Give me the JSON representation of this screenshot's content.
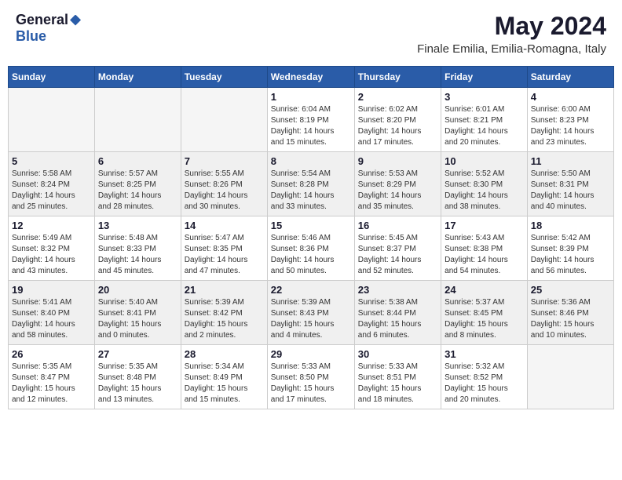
{
  "header": {
    "logo_general": "General",
    "logo_blue": "Blue",
    "month_year": "May 2024",
    "location": "Finale Emilia, Emilia-Romagna, Italy"
  },
  "days_of_week": [
    "Sunday",
    "Monday",
    "Tuesday",
    "Wednesday",
    "Thursday",
    "Friday",
    "Saturday"
  ],
  "weeks": [
    [
      {
        "day": "",
        "info": "",
        "empty": true
      },
      {
        "day": "",
        "info": "",
        "empty": true
      },
      {
        "day": "",
        "info": "",
        "empty": true
      },
      {
        "day": "1",
        "info": "Sunrise: 6:04 AM\nSunset: 8:19 PM\nDaylight: 14 hours\nand 15 minutes.",
        "empty": false
      },
      {
        "day": "2",
        "info": "Sunrise: 6:02 AM\nSunset: 8:20 PM\nDaylight: 14 hours\nand 17 minutes.",
        "empty": false
      },
      {
        "day": "3",
        "info": "Sunrise: 6:01 AM\nSunset: 8:21 PM\nDaylight: 14 hours\nand 20 minutes.",
        "empty": false
      },
      {
        "day": "4",
        "info": "Sunrise: 6:00 AM\nSunset: 8:23 PM\nDaylight: 14 hours\nand 23 minutes.",
        "empty": false
      }
    ],
    [
      {
        "day": "5",
        "info": "Sunrise: 5:58 AM\nSunset: 8:24 PM\nDaylight: 14 hours\nand 25 minutes.",
        "empty": false,
        "shaded": true
      },
      {
        "day": "6",
        "info": "Sunrise: 5:57 AM\nSunset: 8:25 PM\nDaylight: 14 hours\nand 28 minutes.",
        "empty": false,
        "shaded": true
      },
      {
        "day": "7",
        "info": "Sunrise: 5:55 AM\nSunset: 8:26 PM\nDaylight: 14 hours\nand 30 minutes.",
        "empty": false,
        "shaded": true
      },
      {
        "day": "8",
        "info": "Sunrise: 5:54 AM\nSunset: 8:28 PM\nDaylight: 14 hours\nand 33 minutes.",
        "empty": false,
        "shaded": true
      },
      {
        "day": "9",
        "info": "Sunrise: 5:53 AM\nSunset: 8:29 PM\nDaylight: 14 hours\nand 35 minutes.",
        "empty": false,
        "shaded": true
      },
      {
        "day": "10",
        "info": "Sunrise: 5:52 AM\nSunset: 8:30 PM\nDaylight: 14 hours\nand 38 minutes.",
        "empty": false,
        "shaded": true
      },
      {
        "day": "11",
        "info": "Sunrise: 5:50 AM\nSunset: 8:31 PM\nDaylight: 14 hours\nand 40 minutes.",
        "empty": false,
        "shaded": true
      }
    ],
    [
      {
        "day": "12",
        "info": "Sunrise: 5:49 AM\nSunset: 8:32 PM\nDaylight: 14 hours\nand 43 minutes.",
        "empty": false
      },
      {
        "day": "13",
        "info": "Sunrise: 5:48 AM\nSunset: 8:33 PM\nDaylight: 14 hours\nand 45 minutes.",
        "empty": false
      },
      {
        "day": "14",
        "info": "Sunrise: 5:47 AM\nSunset: 8:35 PM\nDaylight: 14 hours\nand 47 minutes.",
        "empty": false
      },
      {
        "day": "15",
        "info": "Sunrise: 5:46 AM\nSunset: 8:36 PM\nDaylight: 14 hours\nand 50 minutes.",
        "empty": false
      },
      {
        "day": "16",
        "info": "Sunrise: 5:45 AM\nSunset: 8:37 PM\nDaylight: 14 hours\nand 52 minutes.",
        "empty": false
      },
      {
        "day": "17",
        "info": "Sunrise: 5:43 AM\nSunset: 8:38 PM\nDaylight: 14 hours\nand 54 minutes.",
        "empty": false
      },
      {
        "day": "18",
        "info": "Sunrise: 5:42 AM\nSunset: 8:39 PM\nDaylight: 14 hours\nand 56 minutes.",
        "empty": false
      }
    ],
    [
      {
        "day": "19",
        "info": "Sunrise: 5:41 AM\nSunset: 8:40 PM\nDaylight: 14 hours\nand 58 minutes.",
        "empty": false,
        "shaded": true
      },
      {
        "day": "20",
        "info": "Sunrise: 5:40 AM\nSunset: 8:41 PM\nDaylight: 15 hours\nand 0 minutes.",
        "empty": false,
        "shaded": true
      },
      {
        "day": "21",
        "info": "Sunrise: 5:39 AM\nSunset: 8:42 PM\nDaylight: 15 hours\nand 2 minutes.",
        "empty": false,
        "shaded": true
      },
      {
        "day": "22",
        "info": "Sunrise: 5:39 AM\nSunset: 8:43 PM\nDaylight: 15 hours\nand 4 minutes.",
        "empty": false,
        "shaded": true
      },
      {
        "day": "23",
        "info": "Sunrise: 5:38 AM\nSunset: 8:44 PM\nDaylight: 15 hours\nand 6 minutes.",
        "empty": false,
        "shaded": true
      },
      {
        "day": "24",
        "info": "Sunrise: 5:37 AM\nSunset: 8:45 PM\nDaylight: 15 hours\nand 8 minutes.",
        "empty": false,
        "shaded": true
      },
      {
        "day": "25",
        "info": "Sunrise: 5:36 AM\nSunset: 8:46 PM\nDaylight: 15 hours\nand 10 minutes.",
        "empty": false,
        "shaded": true
      }
    ],
    [
      {
        "day": "26",
        "info": "Sunrise: 5:35 AM\nSunset: 8:47 PM\nDaylight: 15 hours\nand 12 minutes.",
        "empty": false
      },
      {
        "day": "27",
        "info": "Sunrise: 5:35 AM\nSunset: 8:48 PM\nDaylight: 15 hours\nand 13 minutes.",
        "empty": false
      },
      {
        "day": "28",
        "info": "Sunrise: 5:34 AM\nSunset: 8:49 PM\nDaylight: 15 hours\nand 15 minutes.",
        "empty": false
      },
      {
        "day": "29",
        "info": "Sunrise: 5:33 AM\nSunset: 8:50 PM\nDaylight: 15 hours\nand 17 minutes.",
        "empty": false
      },
      {
        "day": "30",
        "info": "Sunrise: 5:33 AM\nSunset: 8:51 PM\nDaylight: 15 hours\nand 18 minutes.",
        "empty": false
      },
      {
        "day": "31",
        "info": "Sunrise: 5:32 AM\nSunset: 8:52 PM\nDaylight: 15 hours\nand 20 minutes.",
        "empty": false
      },
      {
        "day": "",
        "info": "",
        "empty": true
      }
    ]
  ]
}
